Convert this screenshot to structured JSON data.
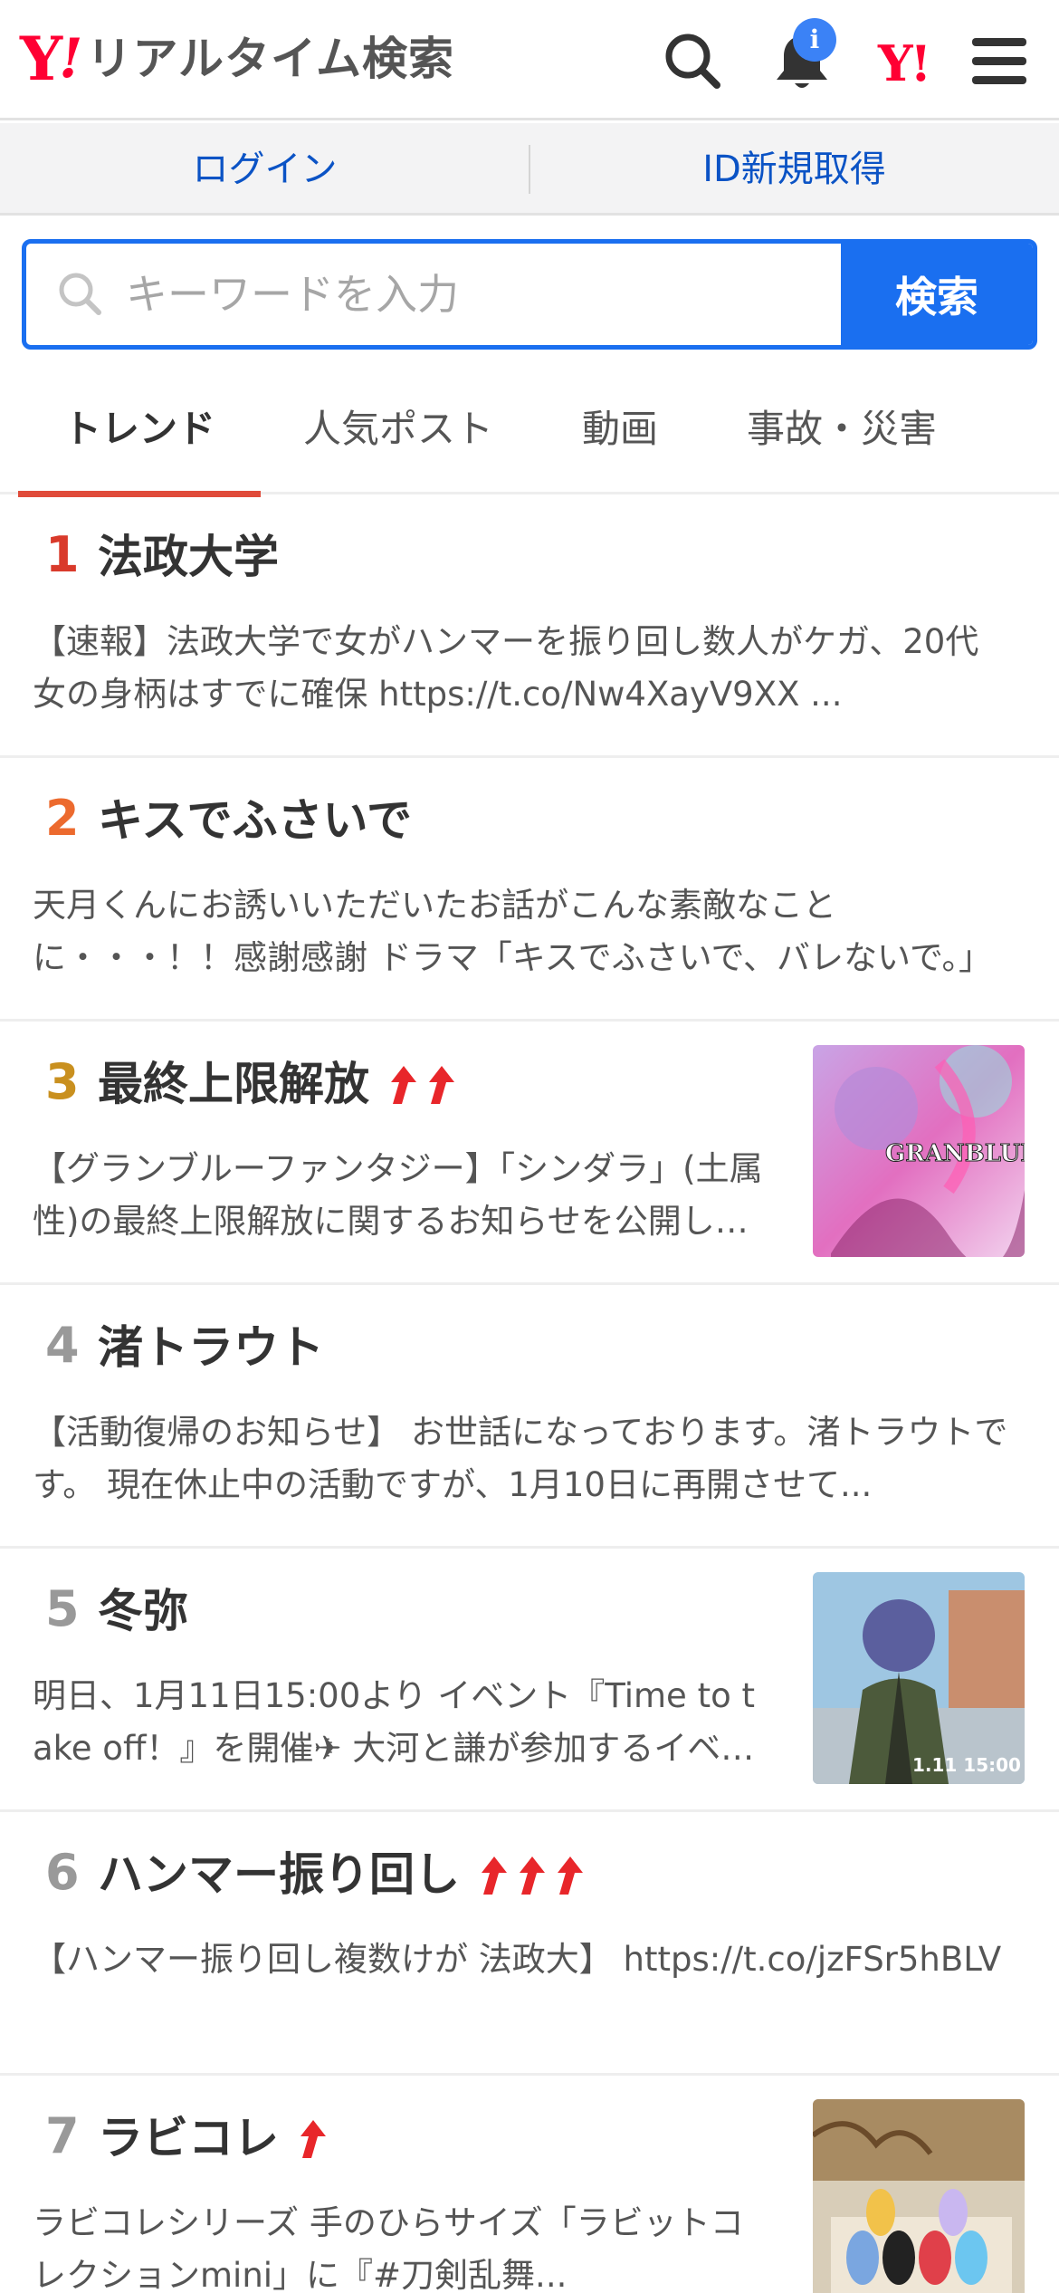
{
  "header": {
    "logo_mark": "Y",
    "logo_exclaim": "!",
    "logo_text": "リアルタイム検索",
    "notification_badge": "i",
    "yahoo_mark": "Y!"
  },
  "login_bar": {
    "login_label": "ログイン",
    "register_label": "ID新規取得"
  },
  "search": {
    "placeholder": "キーワードを入力",
    "button_label": "検索"
  },
  "tabs": [
    {
      "label": "トレンド",
      "active": true
    },
    {
      "label": "人気ポスト",
      "active": false
    },
    {
      "label": "動画",
      "active": false
    },
    {
      "label": "事故・災害",
      "active": false
    }
  ],
  "colors": {
    "brand_red": "#ff0033",
    "accent_blue": "#1a6ff0",
    "link_blue": "#0b53c5",
    "tab_underline": "#e04b3a",
    "rank_1": "#d93a2b",
    "rank_2": "#ec6a2e",
    "rank_3": "#c9901f",
    "rank_other": "#999999",
    "arrow": "#e8262a"
  },
  "trends": [
    {
      "rank": "1",
      "title": "法政大学",
      "arrows": 0,
      "has_thumb": false,
      "desc": "【速報】法政大学で女がハンマーを振り回し数人がケガ、20代女の身柄はすでに確保 https://t.co/Nw4XayV9XX ..."
    },
    {
      "rank": "2",
      "title": "キスでふさいで",
      "arrows": 0,
      "has_thumb": false,
      "desc": "天月くんにお誘いいただいたお話がこんな素敵なことに・・・！！感謝感謝 ドラマ「キスでふさいで、バレないで。」"
    },
    {
      "rank": "3",
      "title": "最終上限解放",
      "arrows": 2,
      "has_thumb": true,
      "thumb_label": "GRANBLUE F",
      "desc": "【グランブルーファンタジー】「シンダラ」(土属性)の最終上限解放に関するお知らせを公開しました"
    },
    {
      "rank": "4",
      "title": "渚トラウト",
      "arrows": 0,
      "has_thumb": false,
      "desc": "【活動復帰のお知らせ】 お世話になっております。渚トラウトです。 現在休止中の活動ですが、1月10日に再開させて..."
    },
    {
      "rank": "5",
      "title": "冬弥",
      "arrows": 0,
      "has_thumb": true,
      "thumb_label": "1.11 15:00",
      "desc": "明日、1月11日15:00より イベント『Time to take off！』を開催✈ 大河と謙が参加するイベントです"
    },
    {
      "rank": "6",
      "title": "ハンマー振り回し",
      "arrows": 3,
      "has_thumb": false,
      "desc": "【ハンマー振り回し複数けが 法政大】 https://t.co/jzFSr5hBLV"
    },
    {
      "rank": "7",
      "title": "ラビコレ",
      "arrows": 1,
      "has_thumb": true,
      "thumb_label": "",
      "desc": "ラビコレシリーズ 手のひらサイズ「ラビットコレクションmini」に『#刀剣乱舞..."
    }
  ]
}
